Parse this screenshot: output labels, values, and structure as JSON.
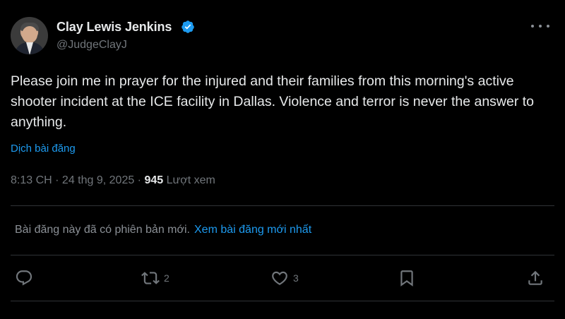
{
  "author": {
    "name": "Clay Lewis Jenkins",
    "handle": "@JudgeClayJ",
    "verified": true,
    "verified_color": "#1d9bf0"
  },
  "post": {
    "text": "Please join me in prayer for the injured and their families from this morning's active shooter incident at the ICE facility in Dallas. Violence and terror is never the answer to anything.",
    "translate_label": "Dịch bài đăng",
    "time": "8:13 CH",
    "separator": " · ",
    "date": "24 thg 9, 2025",
    "views_count": "945",
    "views_label": "Lượt xem"
  },
  "notice": {
    "text": "Bài đăng này đã có phiên bản mới.",
    "link_label": "Xem bài đăng mới nhất"
  },
  "actions": {
    "reply_icon": "reply-icon",
    "repost_icon": "repost-icon",
    "repost_count": "2",
    "like_icon": "heart-icon",
    "like_count": "3",
    "bookmark_icon": "bookmark-icon",
    "share_icon": "share-icon"
  },
  "colors": {
    "background": "#000000",
    "text": "#e7e9ea",
    "secondary": "#71767b",
    "accent": "#1d9bf0",
    "divider": "#2f3336"
  }
}
